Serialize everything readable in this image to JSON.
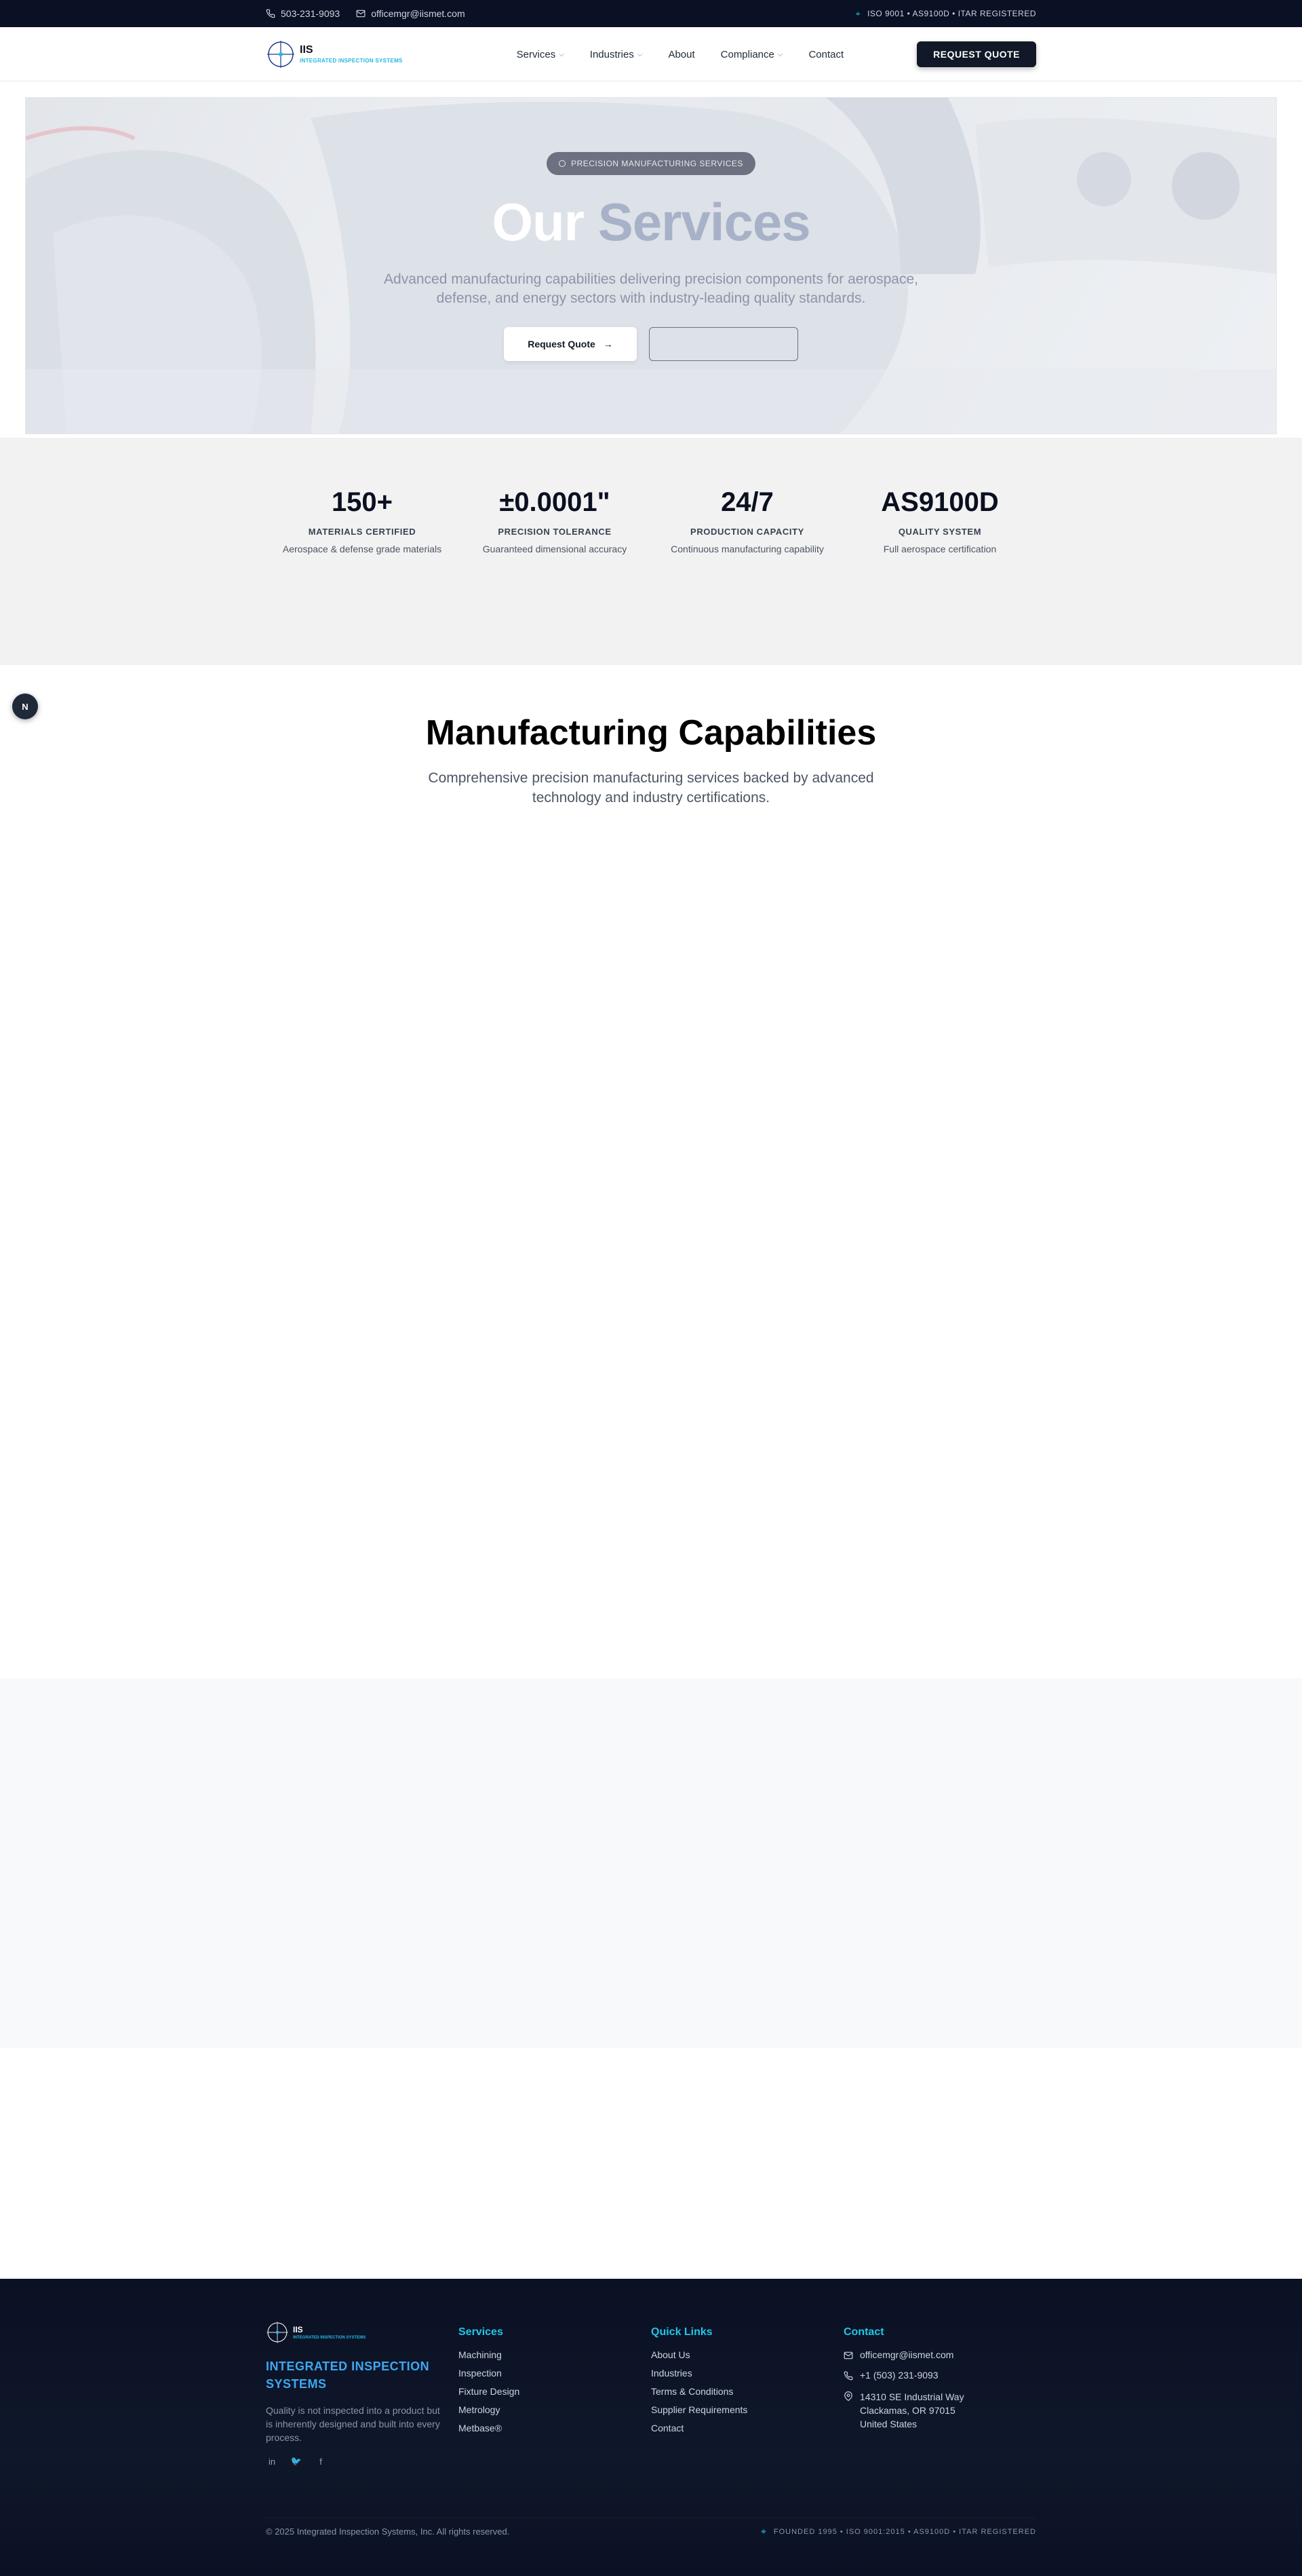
{
  "topbar": {
    "phone": "503-231-9093",
    "email": "officemgr@iismet.com",
    "certs": "ISO 9001 • AS9100D • ITAR REGISTERED"
  },
  "header": {
    "logo_abbr": "IIS",
    "logo_full": "INTEGRATED INSPECTION SYSTEMS",
    "nav": [
      {
        "label": "Services",
        "dropdown": true
      },
      {
        "label": "Industries",
        "dropdown": true
      },
      {
        "label": "About",
        "dropdown": false
      },
      {
        "label": "Compliance",
        "dropdown": true
      },
      {
        "label": "Contact",
        "dropdown": false
      }
    ],
    "cta": "REQUEST QUOTE"
  },
  "hero": {
    "badge": "PRECISION MANUFACTURING SERVICES",
    "title_word1": "Our",
    "title_word2": "Services",
    "subtitle": "Advanced manufacturing capabilities delivering precision components for aerospace, defense, and energy sectors with industry-leading quality standards.",
    "primary_button": "Request Quote"
  },
  "stats": [
    {
      "value": "150+",
      "label": "MATERIALS CERTIFIED",
      "desc": "Aerospace & defense grade materials"
    },
    {
      "value": "±0.0001\"",
      "label": "PRECISION TOLERANCE",
      "desc": "Guaranteed dimensional accuracy"
    },
    {
      "value": "24/7",
      "label": "PRODUCTION CAPACITY",
      "desc": "Continuous manufacturing capability"
    },
    {
      "value": "AS9100D",
      "label": "QUALITY SYSTEM",
      "desc": "Full aerospace certification"
    }
  ],
  "fab_label": "N",
  "capabilities": {
    "title": "Manufacturing Capabilities",
    "subtitle": "Comprehensive precision manufacturing services backed by advanced technology and industry certifications."
  },
  "footer": {
    "logo_abbr": "IIS",
    "logo_full": "INTEGRATED INSPECTION SYSTEMS",
    "company": "INTEGRATED INSPECTION SYSTEMS",
    "tagline": "Quality is not inspected into a product but is inherently designed and built into every process.",
    "services_title": "Services",
    "services": [
      "Machining",
      "Inspection",
      "Fixture Design",
      "Metrology",
      "Metbase®"
    ],
    "links_title": "Quick Links",
    "links": [
      "About Us",
      "Industries",
      "Terms & Conditions",
      "Supplier Requirements",
      "Contact"
    ],
    "contact_title": "Contact",
    "contact_email": "officemgr@iismet.com",
    "contact_phone": "+1 (503) 231-9093",
    "address_line1": "14310 SE Industrial Way",
    "address_line2": "Clackamas, OR 97015",
    "address_line3": "United States",
    "copyright": "© 2025 Integrated Inspection Systems, Inc. All rights reserved.",
    "creds": "FOUNDED 1995 • ISO 9001:2015 • AS9100D • ITAR REGISTERED"
  },
  "colors": {
    "navy": "#0b1124",
    "accent": "#22c5e8",
    "company_blue": "#3ea8f0"
  }
}
